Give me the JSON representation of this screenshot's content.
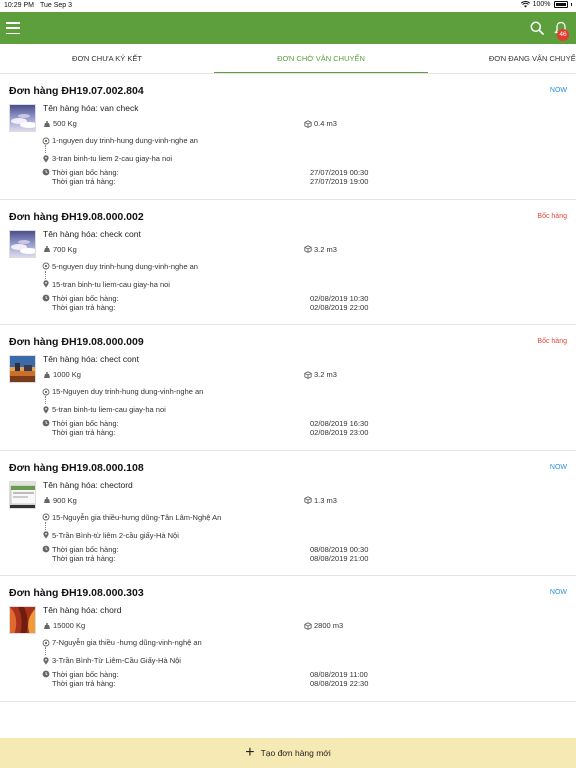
{
  "status_bar": {
    "time": "10:29 PM",
    "date": "Tue Sep 3",
    "battery": "100%"
  },
  "header": {
    "notification_count": "46"
  },
  "tabs": [
    {
      "label": "ĐƠN CHƯA KÝ KẾT",
      "active": false
    },
    {
      "label": "ĐƠN CHỜ VẬN CHUYỂN",
      "active": true
    },
    {
      "label": "ĐƠN ĐANG VẬN CHUYỂN",
      "active": false
    }
  ],
  "orders": [
    {
      "title": "Đơn hàng ĐH19.07.002.804",
      "status": "NOW",
      "status_color": "#2a8fd8",
      "thumb": "sky",
      "goods": "Tên hàng hóa: van check",
      "weight": "500 Kg",
      "volume": "0.4 m3",
      "from": "1-nguyen duy trinh-hung dung-vinh-nghe an",
      "to": "3-tran binh-tu liem 2-cau giay-ha noi",
      "load_label": "Thời gian bốc hàng:",
      "load_time": "27/07/2019 00:30",
      "unload_label": "Thời gian trả hàng:",
      "unload_time": "27/07/2019 19:00"
    },
    {
      "title": "Đơn hàng ĐH19.08.000.002",
      "status": "Bốc hàng",
      "status_color": "#e0463a",
      "thumb": "sky",
      "goods": "Tên hàng hóa: check cont",
      "weight": "700 Kg",
      "volume": "3.2 m3",
      "from": "5-nguyen duy trinh-hung dung-vinh-nghe an",
      "to": "15-tran binh-tu liem-cau giay-ha noi",
      "load_label": "Thời gian bốc hàng:",
      "load_time": "02/08/2019 10:30",
      "unload_label": "Thời gian trả hàng:",
      "unload_time": "02/08/2019 22:00"
    },
    {
      "title": "Đơn hàng ĐH19.08.000.009",
      "status": "Bốc hàng",
      "status_color": "#e0463a",
      "thumb": "sunset",
      "goods": "Tên hàng hóa: chect cont",
      "weight": "1000 Kg",
      "volume": "3.2 m3",
      "from": "15-Nguyen duy trinh-hung dung-vinh-nghe an",
      "to": "5-tran binh-tu liem-cau giay-ha noi",
      "load_label": "Thời gian bốc hàng:",
      "load_time": "02/08/2019 16:30",
      "unload_label": "Thời gian trả hàng:",
      "unload_time": "02/08/2019 23:00"
    },
    {
      "title": "Đơn hàng ĐH19.08.000.108",
      "status": "NOW",
      "status_color": "#2a8fd8",
      "thumb": "screen",
      "goods": "Tên hàng hóa: chectord",
      "weight": "900 Kg",
      "volume": "1.3 m3",
      "from": "15-Nguyễn gia thiều-hưng dũng-Tân Lâm-Nghệ An",
      "to": "5-Trần Bình-từ liêm 2-cầu giấy-Hà Nội",
      "load_label": "Thời gian bốc hàng:",
      "load_time": "08/08/2019 00:30",
      "unload_label": "Thời gian trả hàng:",
      "unload_time": "08/08/2019 21:00"
    },
    {
      "title": "Đơn hàng ĐH19.08.000.303",
      "status": "NOW",
      "status_color": "#2a8fd8",
      "thumb": "canyon",
      "goods": "Tên hàng hóa: chord",
      "weight": "15000 Kg",
      "volume": "2800 m3",
      "from": "7-Nguyễn gia thiều -hưng dũng-vinh-nghệ an",
      "to": "3-Trần Bình-Từ Liêm-Cầu Giấy-Hà Nội",
      "load_label": "Thời gian bốc hàng:",
      "load_time": "08/08/2019 11:00",
      "unload_label": "Thời gian trả hàng:",
      "unload_time": "08/08/2019 22:30"
    }
  ],
  "footer": {
    "create_label": "Tạo đơn hàng mới"
  },
  "colors": {
    "primary": "#5d9e3d",
    "footer_bg": "#f5e9b4",
    "now": "#2a8fd8",
    "loading": "#e0463a"
  }
}
